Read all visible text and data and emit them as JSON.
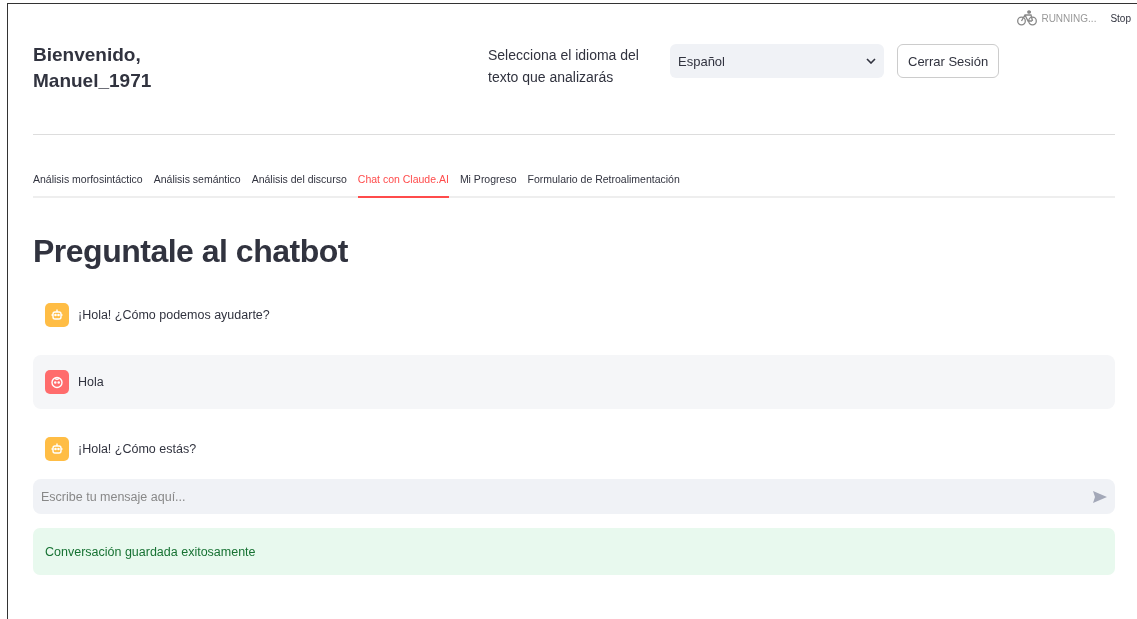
{
  "status": {
    "label": "RUNNING...",
    "stop": "Stop"
  },
  "header": {
    "greeting": "Bienvenido,",
    "user": "Manuel_1971",
    "language_label": "Selecciona el idioma del texto que analizarás",
    "language": "Español",
    "logout": "Cerrar Sesión"
  },
  "tabs": [
    {
      "label": "Análisis morfosintáctico",
      "selected": false
    },
    {
      "label": "Análisis semántico",
      "selected": false
    },
    {
      "label": "Análisis del discurso",
      "selected": false
    },
    {
      "label": "Chat con Claude.AI",
      "selected": true
    },
    {
      "label": "Mi Progreso",
      "selected": false
    },
    {
      "label": "Formulario de Retroalimentación",
      "selected": false
    }
  ],
  "title": "Preguntale al chatbot",
  "messages": [
    {
      "kind": "assistant",
      "text": "¡Hola! ¿Cómo podemos ayudarte?"
    },
    {
      "kind": "user",
      "text": "Hola"
    },
    {
      "kind": "assistant",
      "text": "¡Hola! ¿Cómo estás?"
    }
  ],
  "chat_input": {
    "placeholder": "Escribe tu mensaje aquí..."
  },
  "alert": {
    "kind": "success",
    "text": "Conversación guardada exitosamente"
  }
}
